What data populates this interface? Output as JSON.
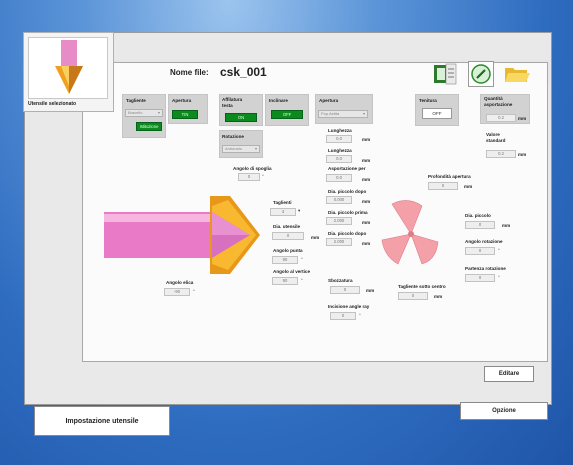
{
  "colors": {
    "background": "#2e6cc0",
    "panel": "#fbfbfb",
    "accent_green": "#0b8a1e",
    "tool_pink": "#e878c8",
    "tool_orange": "#f0a020"
  },
  "tool_card": {
    "label": "Utensile selezionato"
  },
  "header": {
    "file_label": "Nome file:",
    "file_name": "csk_001"
  },
  "toolbar": {
    "icons": [
      "worksheet-icon",
      "edit-pencil-icon",
      "folder-open-icon"
    ]
  },
  "groups": {
    "tagliente": {
      "label": "Tagliente",
      "select_value": "Bravello",
      "green_value": "Istituzione"
    },
    "apertura_small": {
      "label": "Apertura",
      "green_value": "TIN"
    },
    "affilatura": {
      "label": "Affilatura testa",
      "green_value": "ON"
    },
    "inclinare": {
      "label": "Inclinare",
      "green_value": "OFF"
    },
    "apertura": {
      "label": "Apertura",
      "select_value": "Pop Aetita"
    },
    "rotazione": {
      "label": "Rotazione",
      "select_value": "Antiorario"
    }
  },
  "params": {
    "lunghezza_1": {
      "label": "Lunghezza",
      "value": "0.0",
      "unit": "mm"
    },
    "lunghezza_2": {
      "label": "Lunghezza",
      "value": "0.0",
      "unit": "mm"
    },
    "asportazione": {
      "label": "Asportazione per",
      "value": "0.0",
      "unit": "mm"
    },
    "dia_piccolo_dopo": {
      "label": "Dia. piccolo dopo",
      "value": "0.000",
      "unit": "mm"
    },
    "dia_piccolo_prima": {
      "label": "Dia. piccolo prima",
      "value": "2.000",
      "unit": "mm"
    },
    "dia_piccolo_dopo_2": {
      "label": "Dia. piccolo dopo",
      "value": "2.000",
      "unit": "mm"
    },
    "angolo_spoglia": {
      "label": "Angolo di spoglia",
      "value": "0"
    },
    "taglienti": {
      "label": "Taglienti",
      "value": "3"
    },
    "dia_utensile": {
      "label": "Dia. utensile",
      "value": "0",
      "unit": "mm"
    },
    "angolo_punta": {
      "label": "Angolo punta",
      "value": "90"
    },
    "angolo_verticale": {
      "label": "Angolo al vertice",
      "value": "90"
    },
    "angolo_elica": {
      "label": "Angolo elica",
      "value": "-90"
    },
    "sbozzatura": {
      "label": "Sbozzatura",
      "value": "0",
      "unit": "mm"
    },
    "incisione": {
      "label": "Incisione angle ray",
      "value": "0"
    },
    "tagliente_sotto": {
      "label": "Tagliente sotto centro",
      "value": "0",
      "unit": "mm"
    },
    "profondita": {
      "label": "Profondità apertura",
      "value": "0",
      "unit": "mm"
    },
    "dia_piccolo": {
      "label": "Dia. piccolo",
      "value": "0",
      "unit": "mm"
    },
    "angolo_rotazione": {
      "label": "Angolo rotazione",
      "value": "0"
    },
    "partenza_rotazione": {
      "label": "Partenza rotazione",
      "value": "0"
    },
    "tenitura": {
      "label": "Tenitura",
      "value": "OFF"
    },
    "quantita": {
      "label": "Quantità asportazione",
      "value": "0.2",
      "unit": "mm"
    },
    "valore_standard": {
      "label": "Valore standard",
      "value": "0.2",
      "unit": "mm"
    }
  },
  "buttons": {
    "editare": "Editare",
    "impostazione": "Impostazione utensile",
    "opzione": "Opzione"
  }
}
